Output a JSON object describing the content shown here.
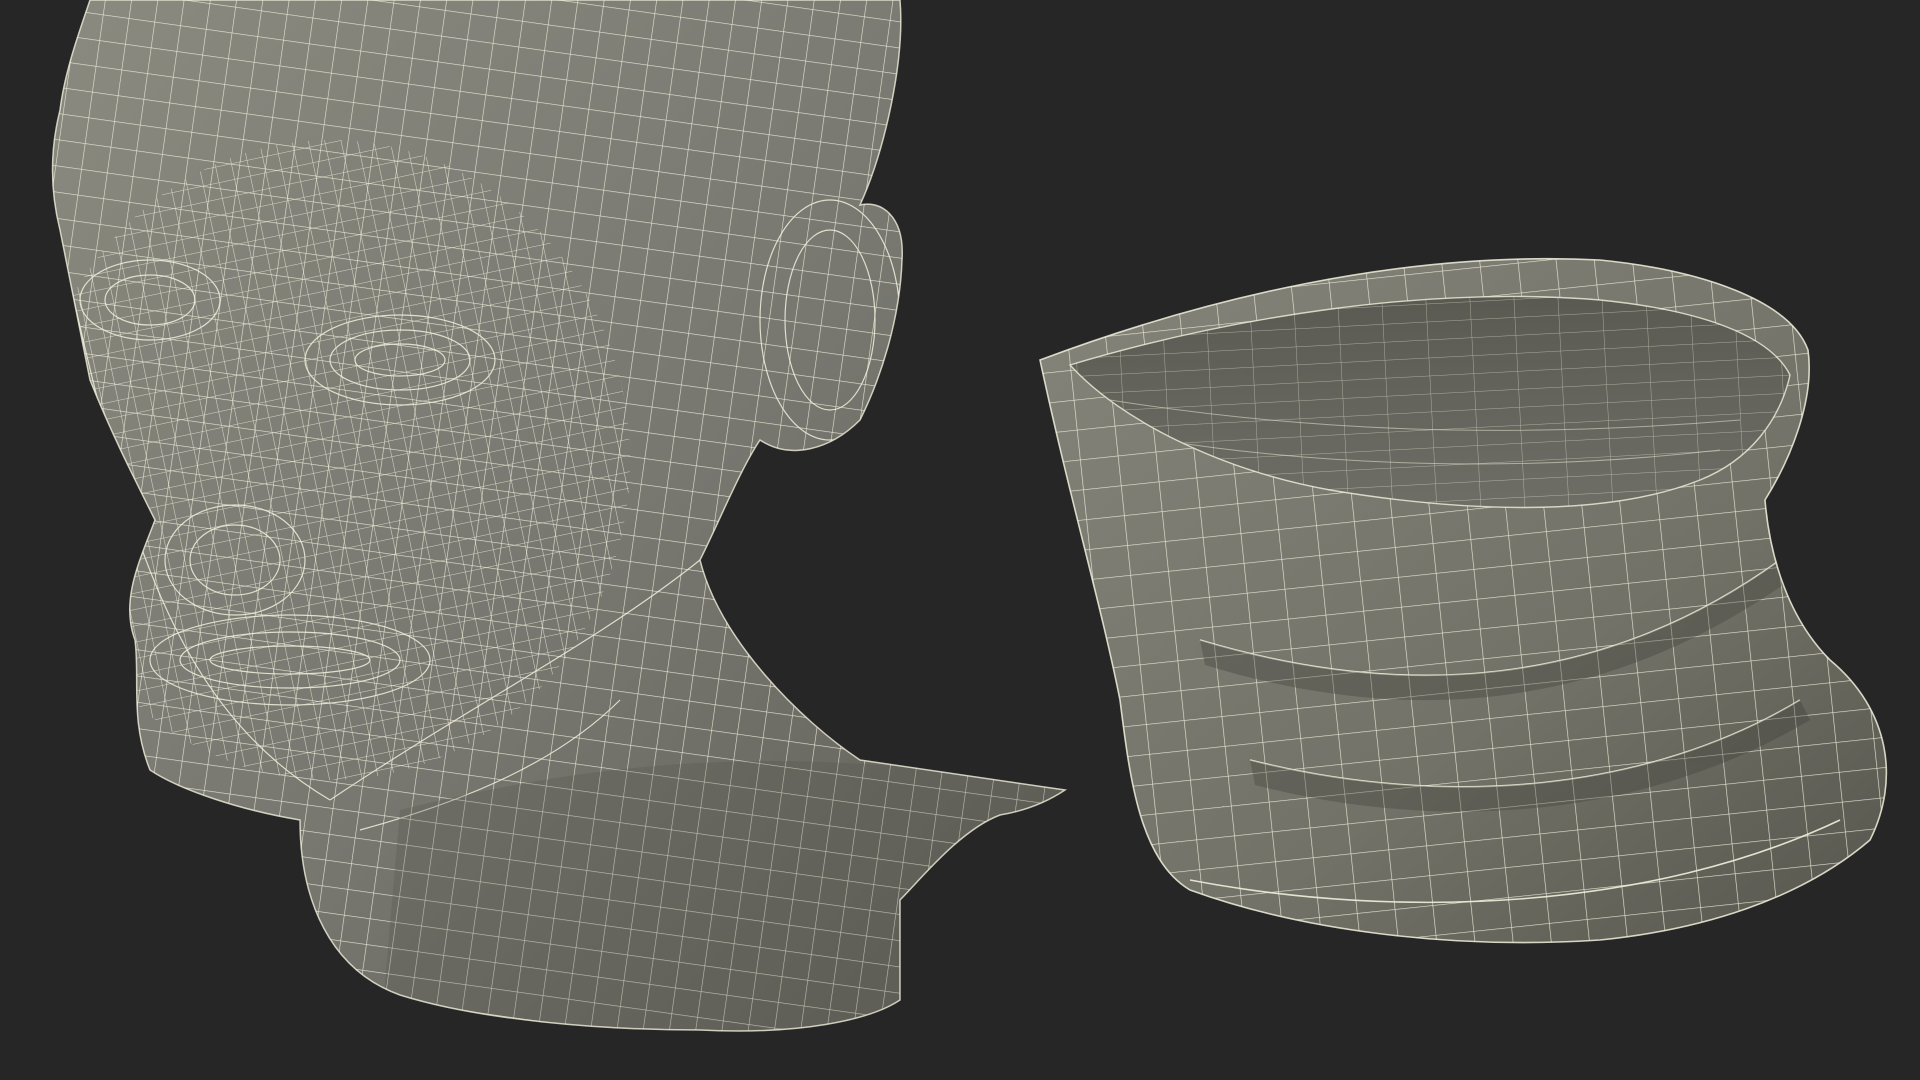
{
  "scene": {
    "background": "#262626",
    "mesh_fill": "#7a7a70",
    "mesh_fill_dark": "#5c5c54",
    "wire_color": "#f2f0dc",
    "objects": [
      "wireframe-head-model-icon",
      "wireframe-neck-gaiter-model-icon"
    ]
  }
}
